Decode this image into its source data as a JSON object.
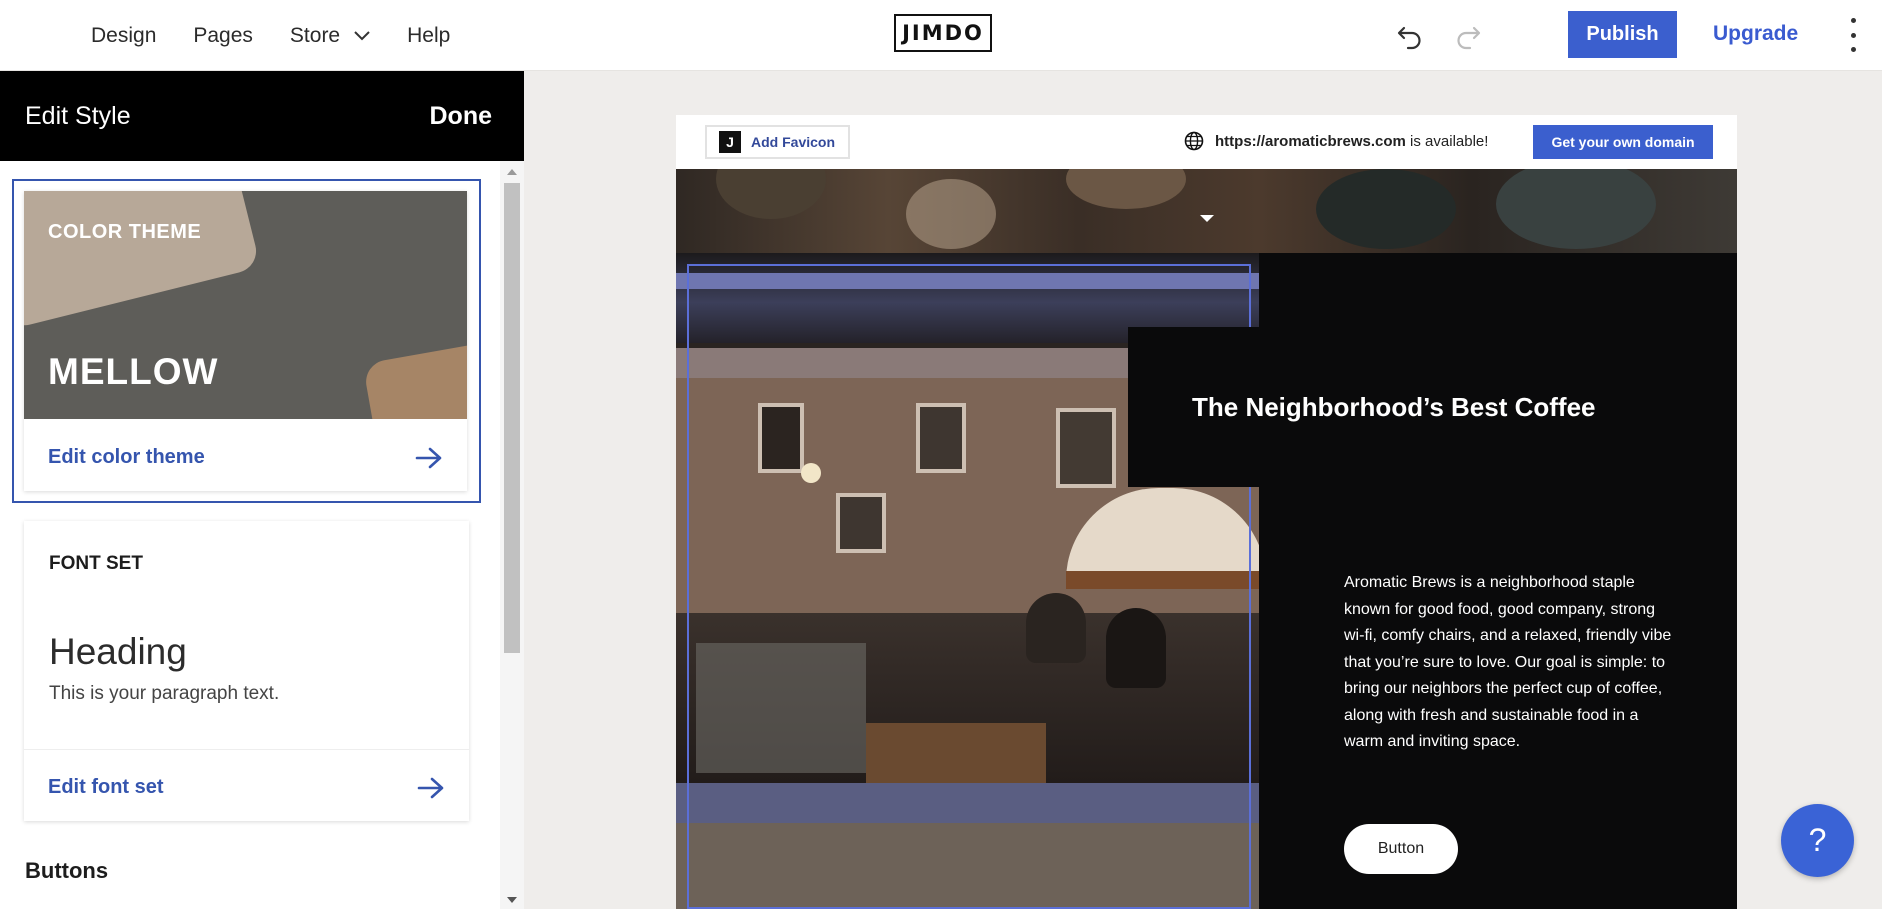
{
  "topbar": {
    "nav": [
      "Design",
      "Pages",
      "Store",
      "Help"
    ],
    "logo": "JIMDO",
    "publish_label": "Publish",
    "upgrade_label": "Upgrade"
  },
  "panel": {
    "title": "Edit Style",
    "done_label": "Done",
    "color_theme": {
      "label": "COLOR THEME",
      "name": "MELLOW",
      "edit_label": "Edit color theme"
    },
    "font_set": {
      "label": "FONT SET",
      "heading_sample": "Heading",
      "paragraph_sample": "This is your paragraph text.",
      "edit_label": "Edit font set"
    },
    "buttons_heading": "Buttons"
  },
  "site": {
    "favicon_label": "Add Favicon",
    "domain": "https://aromaticbrews.com",
    "domain_suffix": " is available!",
    "domain_button": "Get your own domain",
    "hero_title": "The Neighborhood’s Best Coffee",
    "hero_text": "Aromatic Brews is a neighborhood staple known for good food, good company, strong wi-fi, comfy chairs, and a relaxed, friendly vibe that you’re sure to love. Our goal is simple: to bring our neighbors the perfect cup of coffee, along with fresh and sustainable food in a warm and inviting space.",
    "button_label": "Button"
  },
  "help_label": "?",
  "colors": {
    "accent": "#3b5fce",
    "panel_header": "#000000",
    "site_bg": "#0a0a0b",
    "theme_mellow_base": "#5e5d59",
    "theme_mellow_light": "#b7a898",
    "theme_mellow_brown": "#a68566"
  },
  "icons": [
    "chevron-down-icon",
    "undo-icon",
    "redo-icon",
    "more-vertical-icon",
    "arrow-right-icon",
    "globe-icon",
    "jimdo-j-icon",
    "caret-down-icon",
    "help-icon"
  ]
}
